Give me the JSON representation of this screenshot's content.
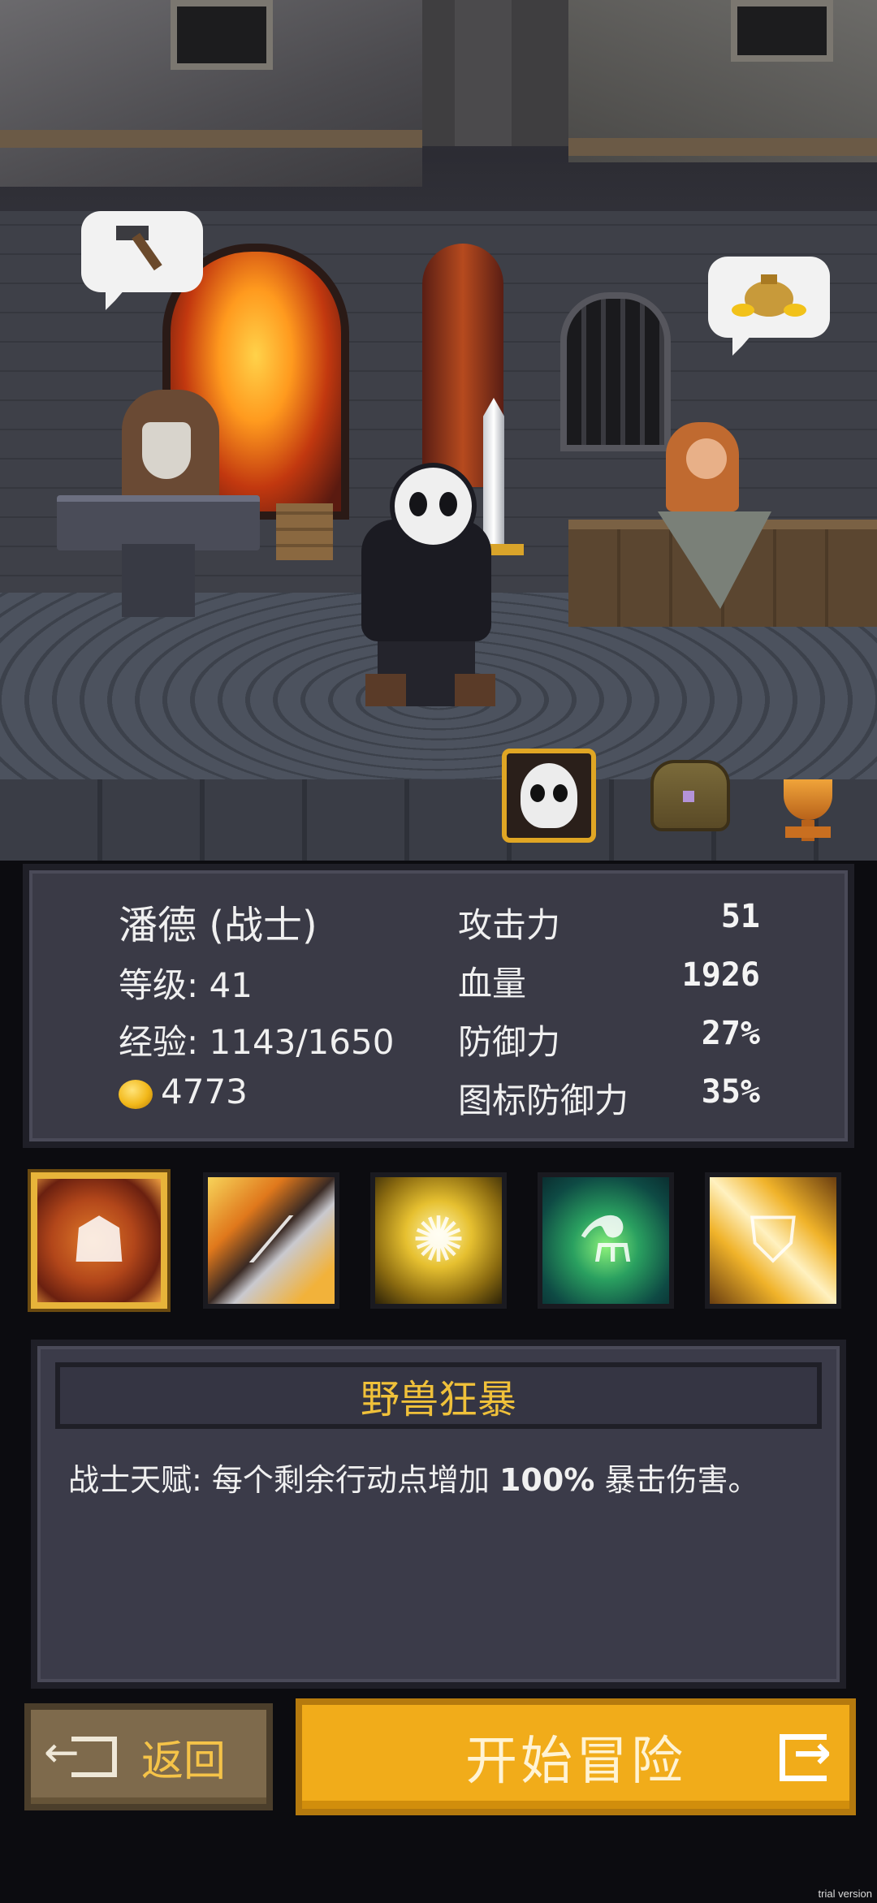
{
  "scene": {
    "blacksmith_bubble_icon": "hammer-icon",
    "merchant_bubble_icon": "money-bag-icon"
  },
  "tabs": [
    {
      "name": "hero-portrait",
      "icon": "panda-portrait-icon",
      "selected": true
    },
    {
      "name": "inventory",
      "icon": "backpack-icon",
      "selected": false
    },
    {
      "name": "achievements",
      "icon": "trophy-icon",
      "selected": false
    }
  ],
  "stats": {
    "hero_name": "潘德 (战士)",
    "level_label": "等级: 41",
    "exp_label": "经验: 1143/1650",
    "gold": "4773",
    "attack_label": "攻击力",
    "attack_value": "51",
    "hp_label": "血量",
    "hp_value": "1926",
    "defense_label": "防御力",
    "defense_value": "27%",
    "icon_defense_label": "图标防御力",
    "icon_defense_value": "35%"
  },
  "skills": [
    {
      "name": "beast-rage",
      "icon": "roaring-beast-icon",
      "selected": true
    },
    {
      "name": "blade-strike",
      "icon": "blade-slash-icon",
      "selected": false
    },
    {
      "name": "golden-idol",
      "icon": "golden-idol-icon",
      "selected": false
    },
    {
      "name": "green-potion",
      "icon": "potion-bottle-icon",
      "selected": false
    },
    {
      "name": "shield",
      "icon": "shield-icon",
      "selected": false
    }
  ],
  "description": {
    "title": "野兽狂暴",
    "body_prefix": "战士天赋: 每个剩余行动点增加 ",
    "body_highlight": "100%",
    "body_suffix": " 暴击伤害。"
  },
  "buttons": {
    "back_label": "返回",
    "start_label": "开始冒险"
  },
  "watermark": "trial version",
  "colors": {
    "accent_gold": "#f1ac1a",
    "title_gold": "#f0c13a",
    "panel_bg": "#3a3a46",
    "back_button": "#7e6a4c"
  }
}
